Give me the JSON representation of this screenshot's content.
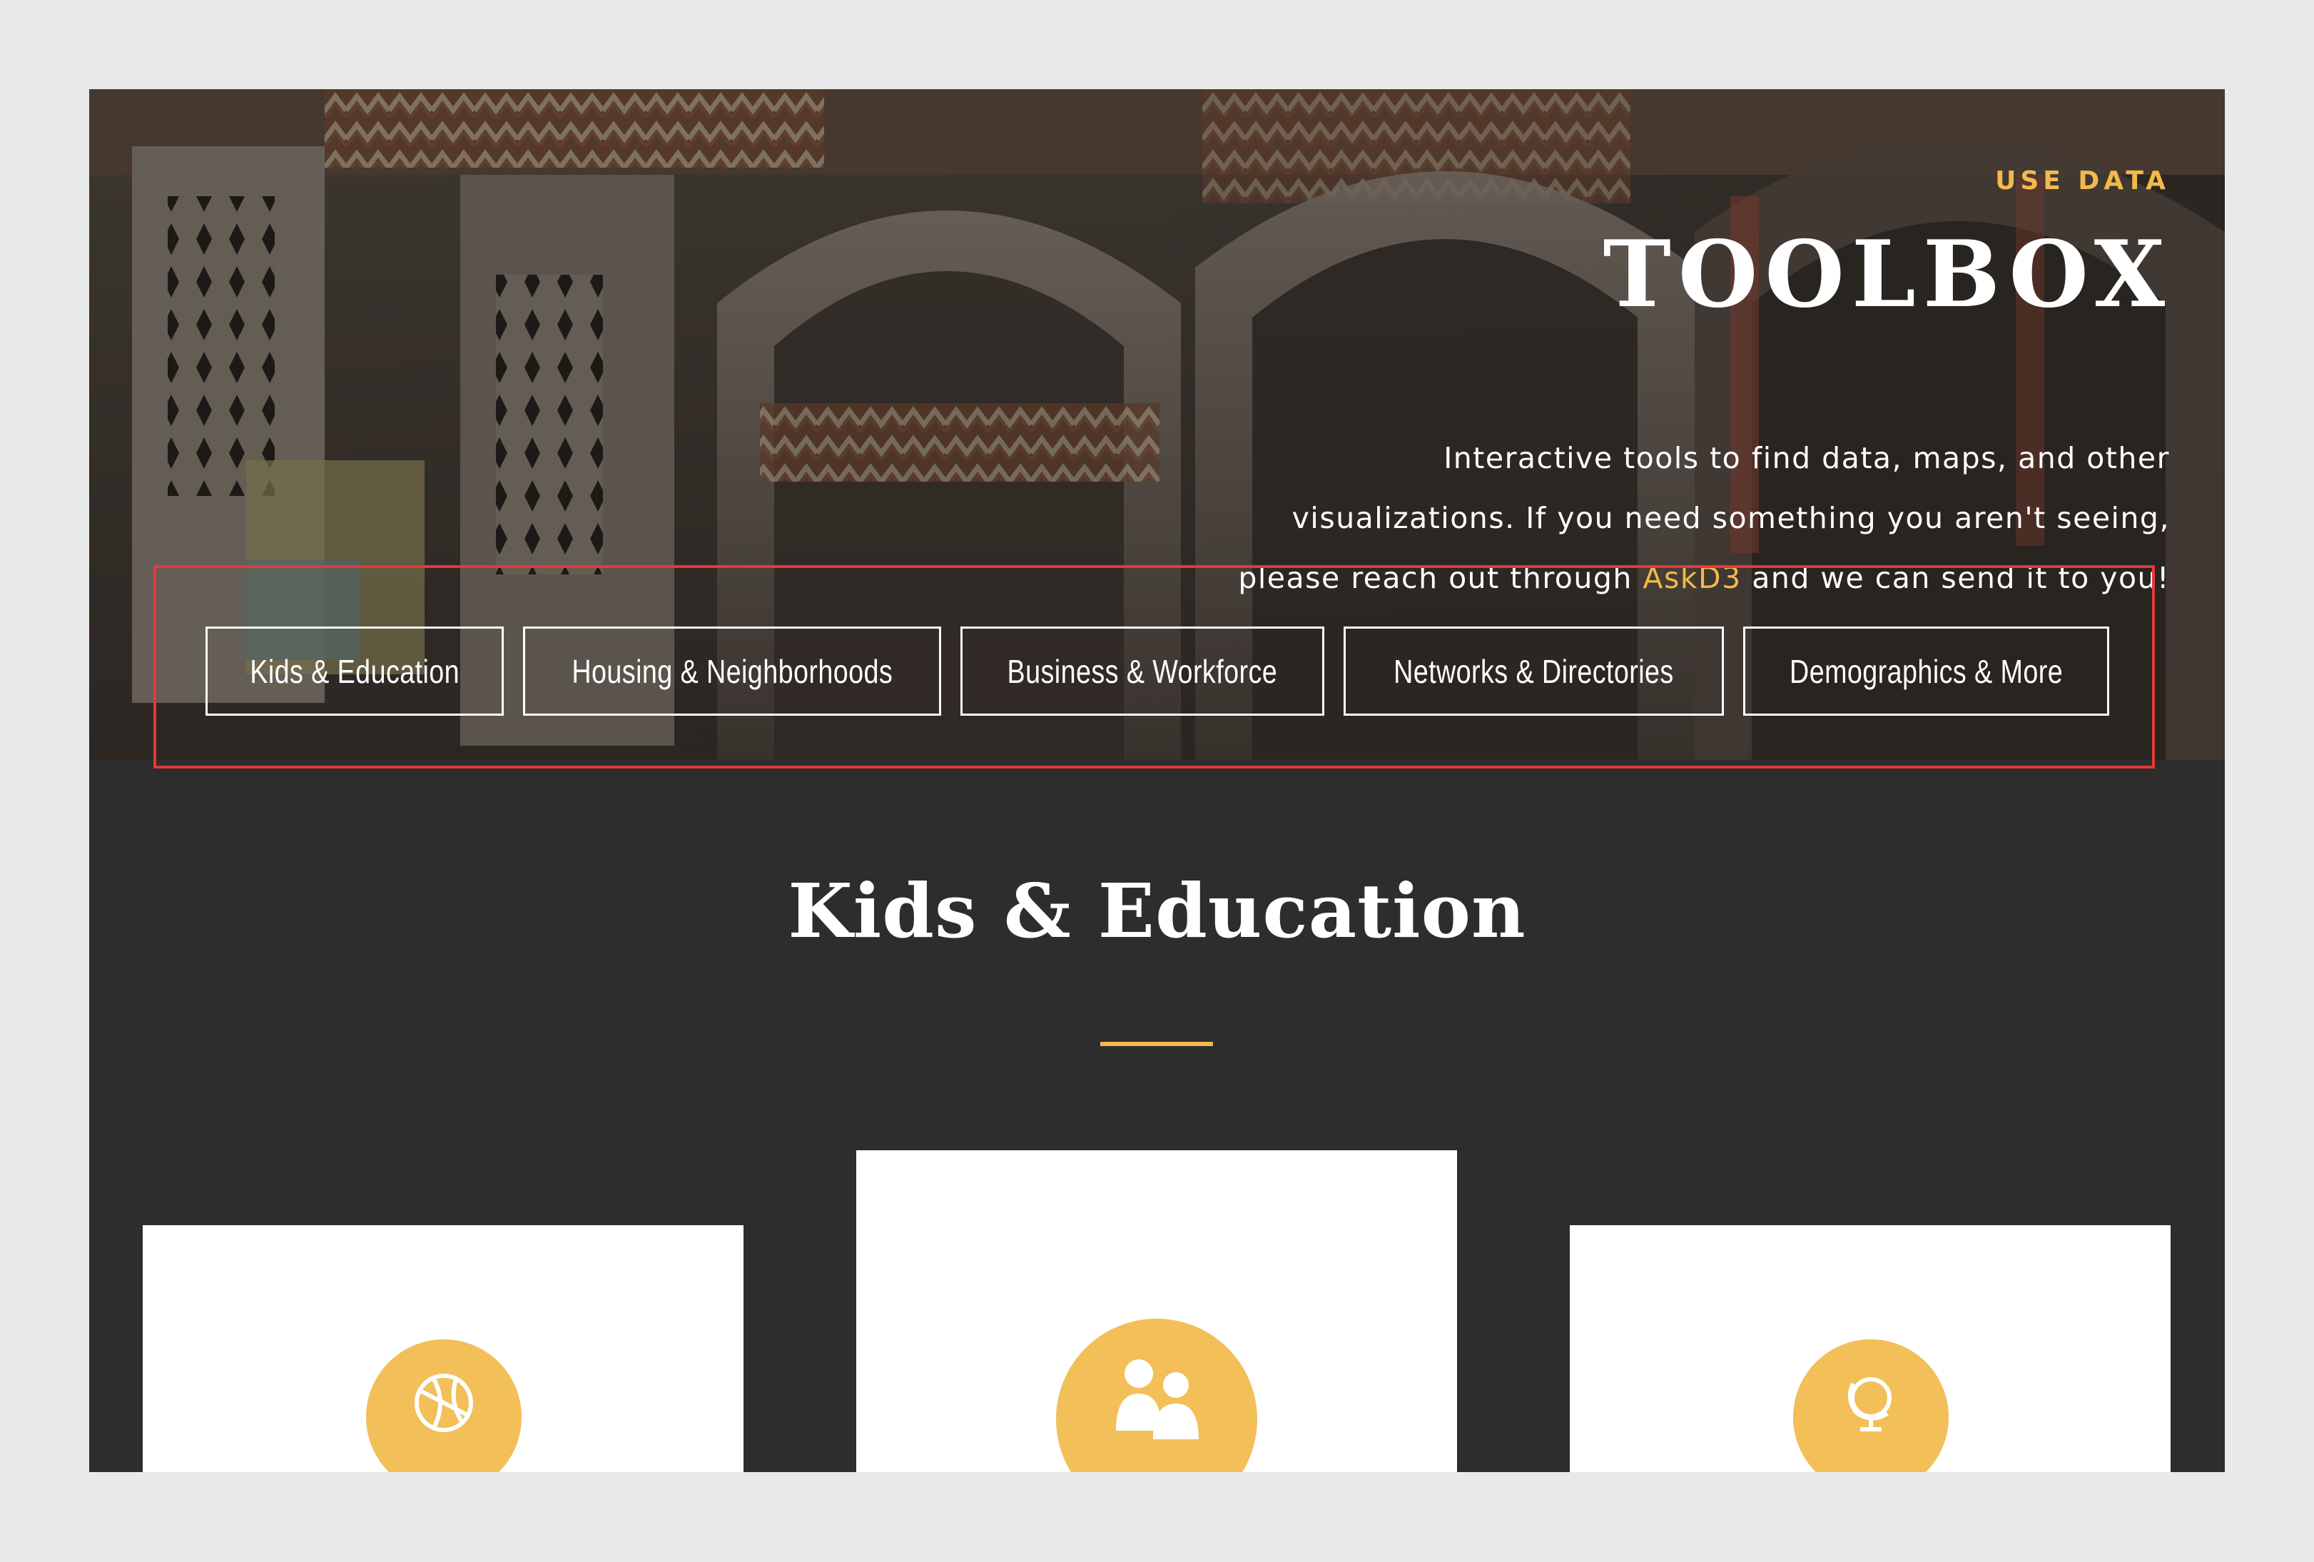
{
  "hero": {
    "eyebrow": "USE DATA",
    "title": "TOOLBOX",
    "description_line1": "Interactive tools to find data, maps, and other",
    "description_line2": "visualizations.  If you need something you aren't seeing,",
    "description_line3_before": "please reach out through ",
    "description_link": "AskD3",
    "description_line3_after": " and we can send it to you!"
  },
  "tabs": [
    {
      "label": "Kids & Education"
    },
    {
      "label": "Housing & Neighborhoods"
    },
    {
      "label": "Business & Workforce"
    },
    {
      "label": "Networks & Directories"
    },
    {
      "label": "Demographics & More"
    }
  ],
  "section": {
    "title": "Kids & Education"
  },
  "cards": [
    {
      "icon": "basketball-icon"
    },
    {
      "icon": "people-icon"
    },
    {
      "icon": "globe-icon"
    }
  ],
  "colors": {
    "accent": "#f2b94b",
    "background_dark": "#2d2d2d",
    "highlight": "#e5383b",
    "page_bg": "#e9e9e9"
  }
}
